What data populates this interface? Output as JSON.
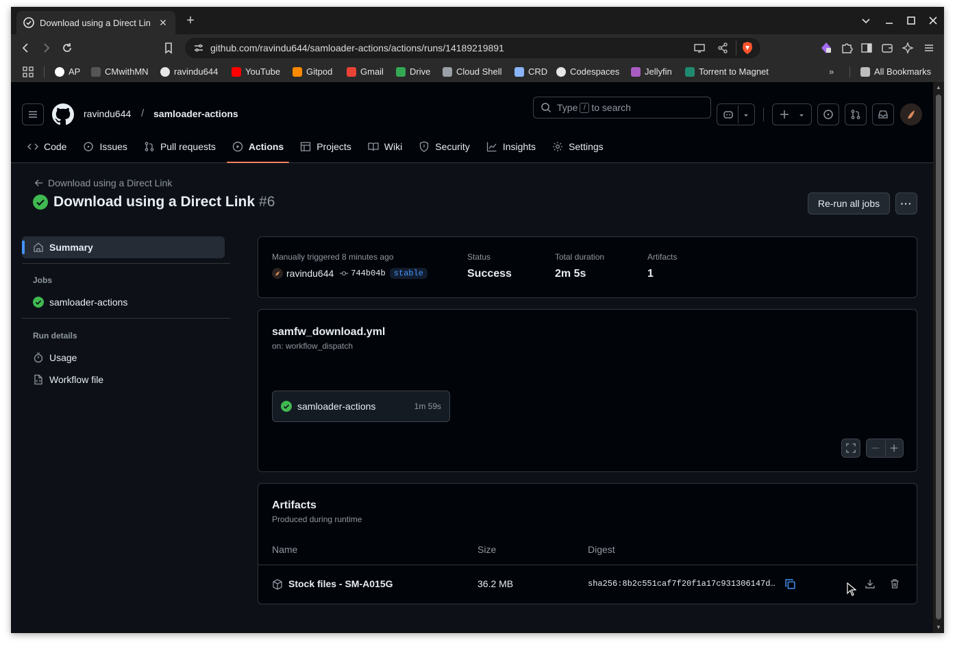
{
  "browser": {
    "tab_title": "Download using a Direct Lin",
    "url": "github.com/ravindu644/samloader-actions/actions/runs/14189219891",
    "bookmarks": [
      "AP",
      "CMwithMN",
      "ravindu644",
      "YouTube",
      "Gitpod",
      "Gmail",
      "Drive",
      "Cloud Shell",
      "CRD",
      "Codespaces",
      "Jellyfin",
      "Torrent to Magnet"
    ],
    "all_bookmarks_label": "All Bookmarks",
    "colors": {
      "tab_bg": "#2a2a2a",
      "toolbar_bg": "#2a2a2a",
      "brave_orange": "#fb542b"
    }
  },
  "header": {
    "owner": "ravindu644",
    "separator": "/",
    "repo": "samloader-actions",
    "search": {
      "prefix": "Type",
      "key": "/",
      "suffix": "to search"
    }
  },
  "nav": {
    "tabs": [
      {
        "label": "Code",
        "icon": "code-icon"
      },
      {
        "label": "Issues",
        "icon": "issue-icon"
      },
      {
        "label": "Pull requests",
        "icon": "pull-request-icon"
      },
      {
        "label": "Actions",
        "icon": "play-icon",
        "active": true
      },
      {
        "label": "Projects",
        "icon": "table-icon"
      },
      {
        "label": "Wiki",
        "icon": "book-icon"
      },
      {
        "label": "Security",
        "icon": "shield-icon"
      },
      {
        "label": "Insights",
        "icon": "graph-icon"
      },
      {
        "label": "Settings",
        "icon": "gear-icon"
      }
    ]
  },
  "run": {
    "back_label": "Download using a Direct Link",
    "title": "Download using a Direct Link",
    "number": "#6",
    "rerun_label": "Re-run all jobs",
    "more_label": "···"
  },
  "sidebar": {
    "summary_label": "Summary",
    "jobs_heading": "Jobs",
    "job_name": "samloader-actions",
    "run_details_heading": "Run details",
    "usage_label": "Usage",
    "workflow_file_label": "Workflow file"
  },
  "summary": {
    "trigger_text": "Manually triggered 8 minutes ago",
    "actor": "ravindu644",
    "commit": "744b04b",
    "branch": "stable",
    "status_label": "Status",
    "status_value": "Success",
    "duration_label": "Total duration",
    "duration_value": "2m 5s",
    "artifacts_label": "Artifacts",
    "artifacts_value": "1"
  },
  "workflow": {
    "file": "samfw_download.yml",
    "trigger": "on: workflow_dispatch",
    "job_name": "samloader-actions",
    "job_duration": "1m 59s"
  },
  "artifacts": {
    "title": "Artifacts",
    "subtitle": "Produced during runtime",
    "columns": [
      "Name",
      "Size",
      "Digest"
    ],
    "rows": [
      {
        "name": "Stock files - SM-A015G",
        "size": "36.2 MB",
        "digest": "sha256:8b2c551caf7f20f1a17c931306147d…"
      }
    ]
  },
  "colors": {
    "page_bg": "#0d1117",
    "header_bg": "#010409",
    "border": "#30363d",
    "success_green": "#3fb950",
    "accent_blue": "#4493f8",
    "active_tab_underline": "#f78166"
  }
}
